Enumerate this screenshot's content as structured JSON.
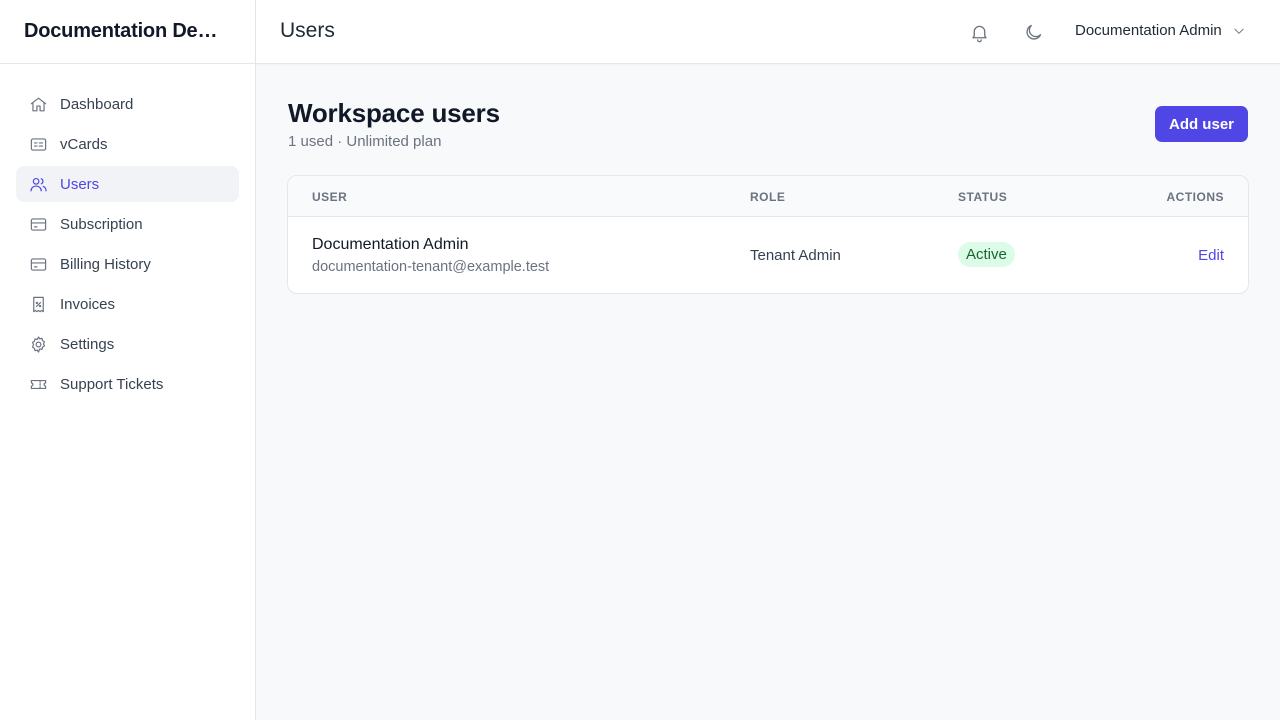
{
  "brand": {
    "name": "Documentation Demo Tenant"
  },
  "sidebar": {
    "items": [
      {
        "label": "Dashboard",
        "icon": "home-icon"
      },
      {
        "label": "vCards",
        "icon": "id-card-icon"
      },
      {
        "label": "Users",
        "icon": "users-icon",
        "active": true
      },
      {
        "label": "Subscription",
        "icon": "credit-card-icon"
      },
      {
        "label": "Billing History",
        "icon": "credit-card-icon"
      },
      {
        "label": "Invoices",
        "icon": "receipt-icon"
      },
      {
        "label": "Settings",
        "icon": "gear-icon"
      },
      {
        "label": "Support Tickets",
        "icon": "ticket-icon"
      }
    ]
  },
  "header": {
    "title": "Users",
    "user_name": "Documentation Admin"
  },
  "main": {
    "heading": "Workspace users",
    "subtitle": "1 used · Unlimited plan",
    "add_button": "Add user",
    "table": {
      "columns": [
        "USER",
        "ROLE",
        "STATUS",
        "ACTIONS"
      ],
      "rows": [
        {
          "name": "Documentation Admin",
          "email": "documentation-tenant@example.test",
          "role": "Tenant Admin",
          "status": "Active",
          "action": "Edit"
        }
      ]
    }
  },
  "colors": {
    "accent": "#4f46e5",
    "active_badge_bg": "#dcfce7",
    "active_badge_text": "#166534"
  }
}
